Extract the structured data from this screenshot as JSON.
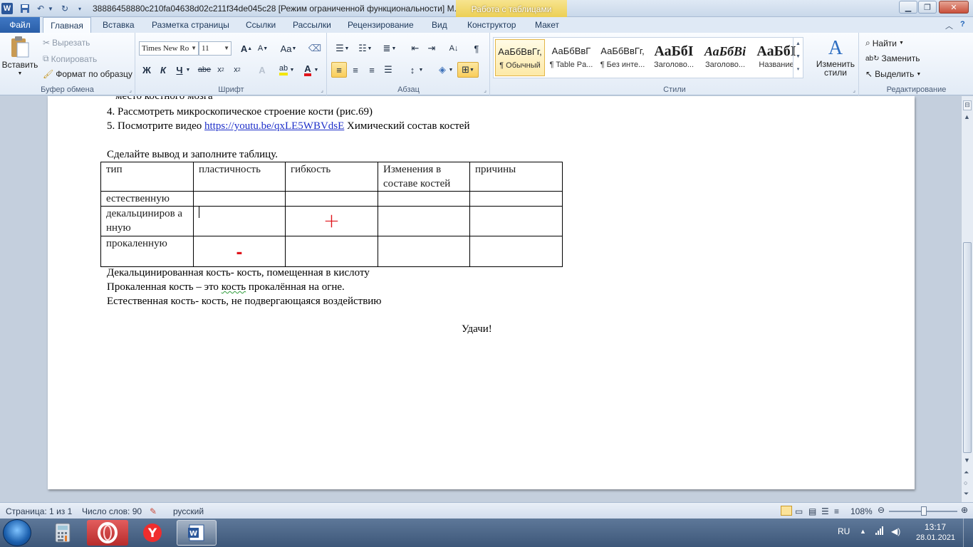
{
  "titlebar": {
    "title": "38886458880c210fa04638d02c211f34de045c28 [Режим ограниченной функциональности] M...",
    "context_tab": "Работа с таблицами"
  },
  "tabs": [
    "Файл",
    "Главная",
    "Вставка",
    "Разметка страницы",
    "Ссылки",
    "Рассылки",
    "Рецензирование",
    "Вид",
    "Конструктор",
    "Макет"
  ],
  "ribbon": {
    "clipboard": {
      "paste": "Вставить",
      "cut": "Вырезать",
      "copy": "Копировать",
      "format_painter": "Формат по образцу",
      "label": "Буфер обмена"
    },
    "font": {
      "name": "Times New Ro",
      "size": "11",
      "bold": "Ж",
      "italic": "К",
      "underline": "Ч",
      "strike": "abe",
      "label": "Шрифт"
    },
    "paragraph": {
      "label": "Абзац"
    },
    "styles": {
      "items": [
        {
          "preview": "АаБбВвГг,",
          "name": "¶ Обычный"
        },
        {
          "preview": "АаБбВвГ",
          "name": "¶ Table Pa..."
        },
        {
          "preview": "АаБбВвГг,",
          "name": "¶ Без инте..."
        },
        {
          "preview": "АаБбІ",
          "name": "Заголово..."
        },
        {
          "preview": "АаБбВі",
          "name": "Заголово..."
        },
        {
          "preview": "АаБбІ",
          "name": "Название"
        }
      ],
      "change_line1": "Изменить",
      "change_line2": "стили",
      "label": "Стили"
    },
    "editing": {
      "find": "Найти",
      "replace": "Заменить",
      "select": "Выделить",
      "label": "Редактирование"
    }
  },
  "document": {
    "line_partial": "место костного мозга",
    "line4": "4. Рассмотреть микроскопическое строение кости (рис.69)",
    "line5_prefix": "5. Посмотрите видео ",
    "line5_link": "https://youtu.be/qxLE5WBVdsE",
    "line5_suffix": "  Химический состав костей",
    "instruction": "Сделайте вывод и заполните таблицу.",
    "table": {
      "headers": [
        "тип",
        "пластичность",
        "гибкость",
        "Изменения в составе костей",
        "причины"
      ],
      "rows": [
        {
          "type": "естественную",
          "plastic": "",
          "flex": ""
        },
        {
          "type": "декальциниров анную",
          "plastic": "",
          "flex": "+"
        },
        {
          "type": "прокаленную",
          "plastic": "-",
          "flex": ""
        }
      ]
    },
    "def1": "Декальцинированная кость- кость, помещенная в кислоту",
    "def2_a": "Прокаленная кость – это ",
    "def2_b": "кость",
    "def2_c": " прокалённая на огне.",
    "def3": "Естественная кость- кость, не подвергающаяся воздействию",
    "closing": "Удачи!"
  },
  "statusbar": {
    "page": "Страница: 1 из 1",
    "words": "Число слов: 90",
    "language": "русский",
    "zoom": "108%"
  },
  "taskbar": {
    "lang": "RU",
    "time": "13:17",
    "date": "28.01.2021"
  },
  "colors": {
    "accent_blue": "#2b579a",
    "context_yellow": "#eccf55",
    "mark_red": "#e0141b"
  }
}
